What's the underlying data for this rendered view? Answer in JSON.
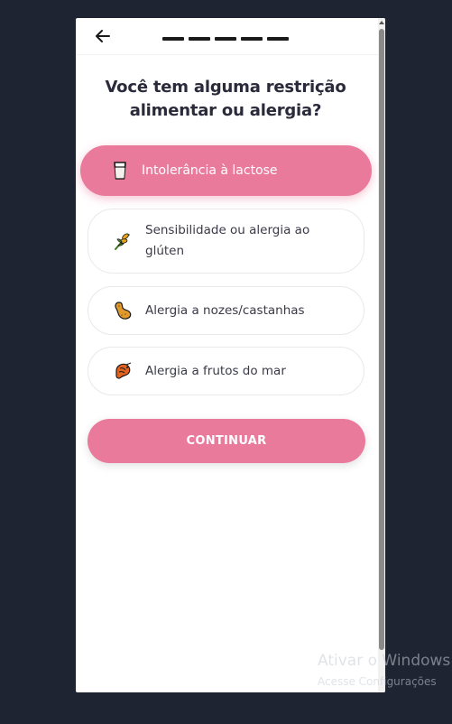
{
  "header": {
    "back_icon": "arrow-left-icon",
    "progress_steps": 5,
    "progress_current": 5
  },
  "question": {
    "title": "Você tem alguma restrição alimentar ou alergia?"
  },
  "options": [
    {
      "label": "Intolerância à lactose",
      "icon": "milk-glass-icon",
      "selected": true
    },
    {
      "label": "Sensibilidade ou alergia ao glúten",
      "icon": "wheat-icon",
      "selected": false
    },
    {
      "label": "Alergia a nozes/castanhas",
      "icon": "peanut-icon",
      "selected": false
    },
    {
      "label": "Alergia a frutos do mar",
      "icon": "shrimp-icon",
      "selected": false
    }
  ],
  "continue_button": {
    "label": "CONTINUAR"
  },
  "watermark": {
    "title": "Ativar o Windows",
    "subtitle": "Acesse Configurações"
  },
  "colors": {
    "accent": "#ea7a9c",
    "background": "#1f2433",
    "card": "#ffffff",
    "text": "#2a2a3a"
  }
}
